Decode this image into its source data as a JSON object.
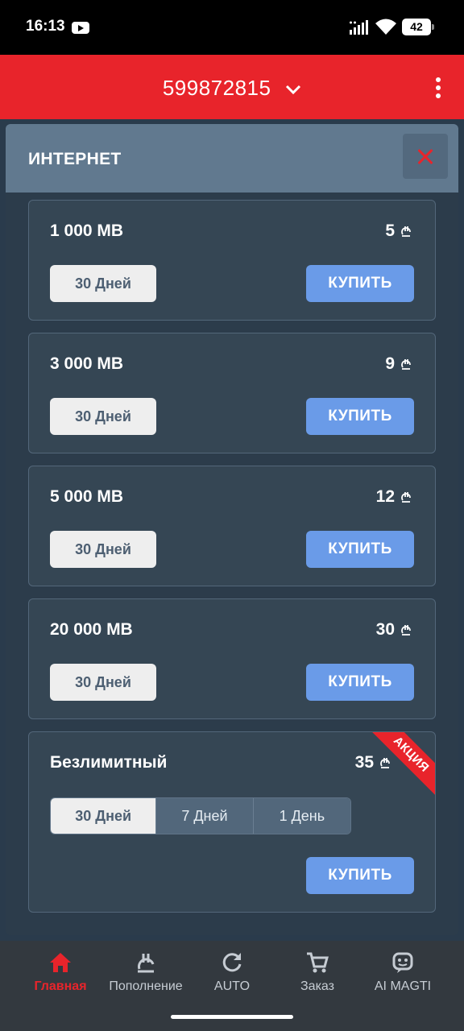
{
  "status_bar": {
    "time": "16:13",
    "battery": "42"
  },
  "header": {
    "phone_number": "599872815"
  },
  "modal": {
    "title": "ИНТЕРНЕТ",
    "packages": [
      {
        "title": "1 000 MB",
        "price": "5",
        "days": "30 Дней",
        "buy": "КУПИТЬ"
      },
      {
        "title": "3 000 MB",
        "price": "9",
        "days": "30 Дней",
        "buy": "КУПИТЬ"
      },
      {
        "title": "5 000 MB",
        "price": "12",
        "days": "30 Дней",
        "buy": "КУПИТЬ"
      },
      {
        "title": "20 000 MB",
        "price": "30",
        "days": "30 Дней",
        "buy": "КУПИТЬ"
      }
    ],
    "unlimited": {
      "title": "Безлимитный",
      "price": "35",
      "promo": "АКЦИЯ",
      "options": [
        "30 Дней",
        "7 Дней",
        "1 День"
      ],
      "selected": "30 Дней",
      "buy": "КУПИТЬ"
    }
  },
  "bottom_nav": {
    "items": [
      {
        "label": "Главная",
        "icon": "home-icon",
        "active": true
      },
      {
        "label": "Пополнение",
        "icon": "lari-coin-icon",
        "active": false
      },
      {
        "label": "AUTO",
        "icon": "refresh-icon",
        "active": false
      },
      {
        "label": "Заказ",
        "icon": "cart-icon",
        "active": false
      },
      {
        "label": "AI MAGTI",
        "icon": "chat-bot-icon",
        "active": false
      }
    ]
  },
  "colors": {
    "accent_red": "#e8242b",
    "buy_blue": "#6a9be8",
    "modal_header": "#61798f",
    "card_bg": "#354654"
  }
}
